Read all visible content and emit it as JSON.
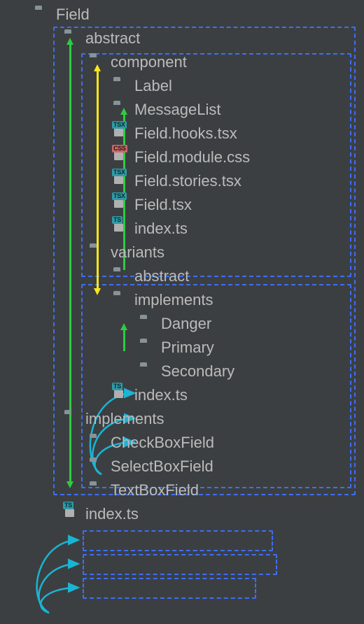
{
  "colors": {
    "dashed": "#3e6ef3",
    "greenArrow": "#2ecc40",
    "yellowArrow": "#f8e71c",
    "cyanArrow": "#1ab4d4",
    "bg": "#3c3f41",
    "text": "#bbbbbb"
  },
  "tree": {
    "field": "Field",
    "abstract": "abstract",
    "component": "component",
    "label": "Label",
    "messageList": "MessageList",
    "fieldHooks": "Field.hooks.tsx",
    "fieldModule": "Field.module.css",
    "fieldStories": "Field.stories.tsx",
    "fieldTsx": "Field.tsx",
    "indexTs1": "index.ts",
    "variants": "variants",
    "variantsAbstract": "abstract",
    "variantsImplements": "implements",
    "danger": "Danger",
    "primary": "Primary",
    "secondary": "Secondary",
    "indexTs2": "index.ts",
    "implements": "implements",
    "checkBoxField": "CheckBoxField",
    "selectBoxField": "SelectBoxField",
    "textBoxField": "TextBoxField",
    "indexTs3": "index.ts"
  }
}
